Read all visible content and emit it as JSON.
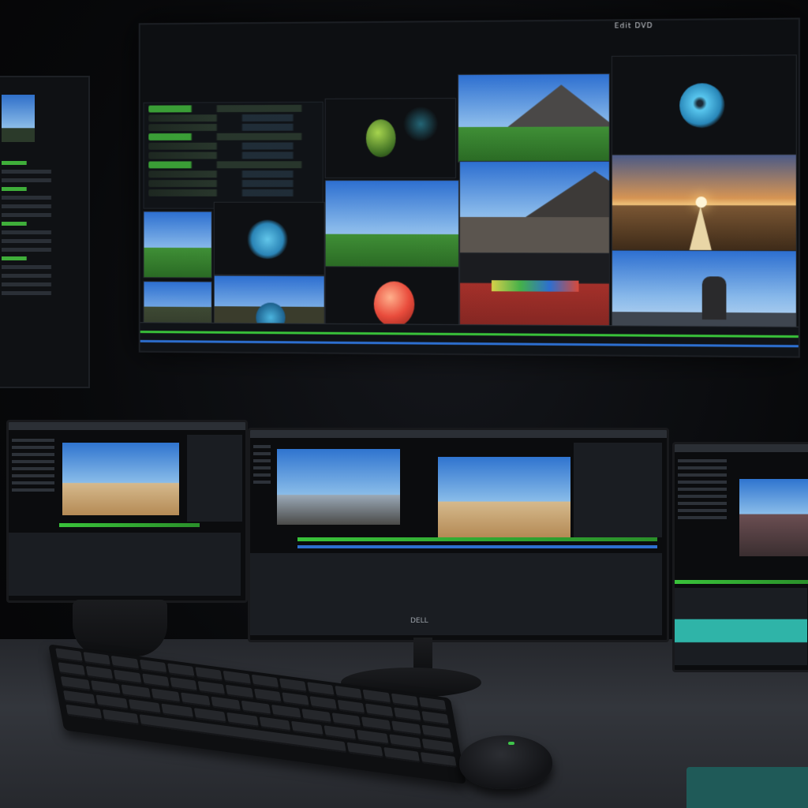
{
  "wall_monitor": {
    "topbar_text": "Edit  DVD"
  },
  "desk_monitor": {
    "brand": "DELL"
  },
  "colors": {
    "timeline_green": "#39c23a",
    "timeline_blue": "#2d6fd0",
    "background": "#07080a",
    "desk": "#2e3036"
  }
}
